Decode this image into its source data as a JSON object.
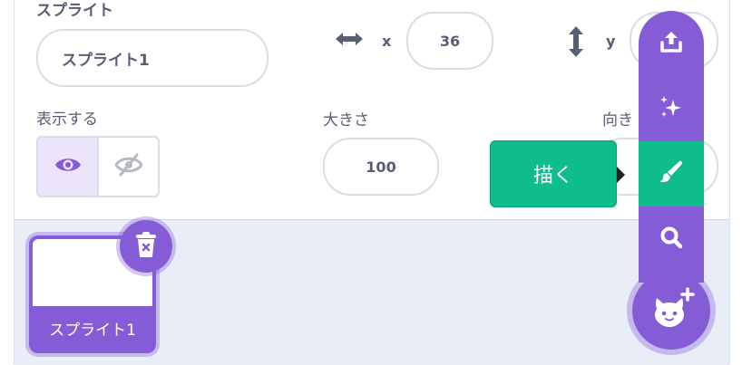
{
  "sprite_info": {
    "sprite_label": "スプライト",
    "sprite_name_value": "スプライト1",
    "x_label": "x",
    "x_value": "36",
    "y_label": "y",
    "show_label": "表示する",
    "size_label": "大きさ",
    "size_value": "100",
    "direction_label": "向き"
  },
  "sprite_list": [
    {
      "name": "スプライト1",
      "selected": true
    }
  ],
  "add_sprite_menu": {
    "items": [
      "upload-icon",
      "surprise-icon",
      "paint-icon",
      "search-icon"
    ],
    "active_item": "paint-icon",
    "tooltip": "描く"
  },
  "colors": {
    "accent": "#855cd6",
    "active": "#0fbd8c",
    "text": "#575e75"
  }
}
